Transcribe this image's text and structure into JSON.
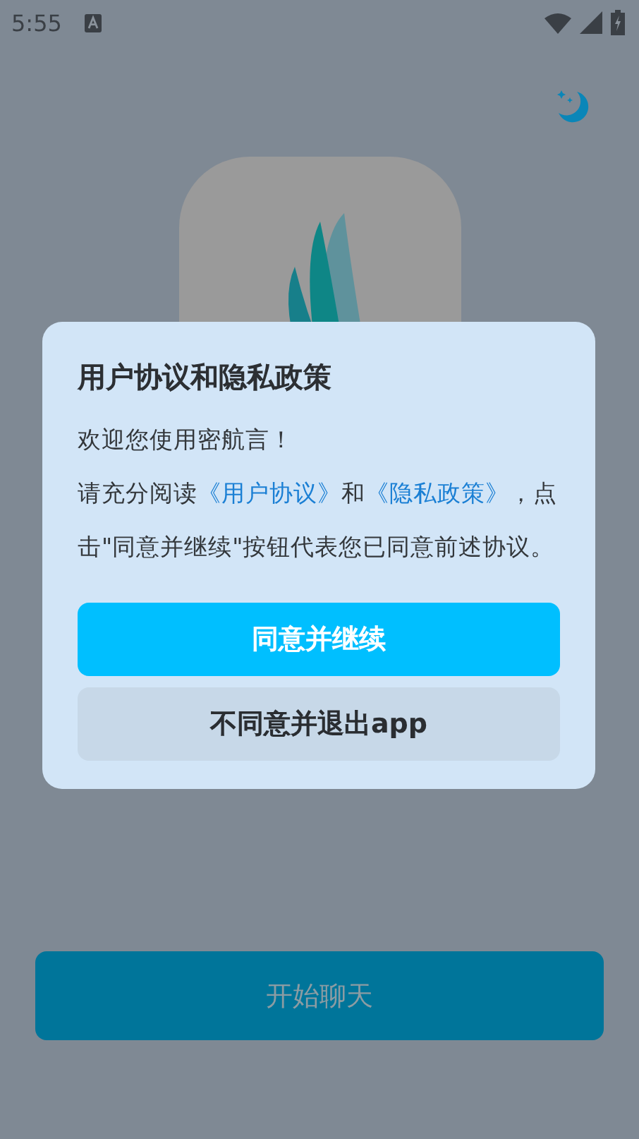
{
  "status_bar": {
    "time": "5:55"
  },
  "dialog": {
    "title": "用户协议和隐私政策",
    "greeting": "欢迎您使用密航言！",
    "body": {
      "before": "请充分阅读",
      "link_1": "《用户协议》",
      "middle": "和",
      "link_2": "《隐私政策》",
      "after": "，点击\"同意并继续\"按钮代表您已同意前述协议。"
    },
    "buttons": [
      {
        "kind": "primary",
        "label": "同意并继续"
      },
      {
        "kind": "secondary",
        "label": "不同意并退出app"
      }
    ]
  },
  "start_button": {
    "label": "开始聊天",
    "disabled": true
  }
}
